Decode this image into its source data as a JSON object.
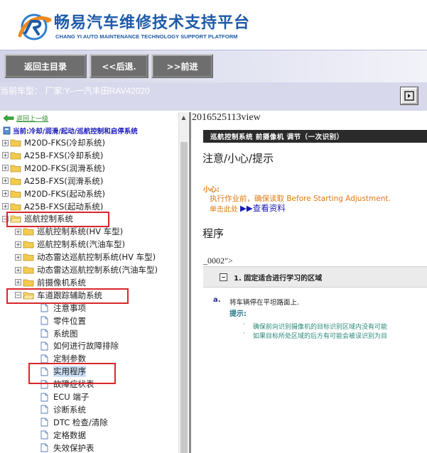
{
  "header": {
    "title_cn": "畅易汽车维修技术支持平台",
    "title_en": "CHANG YI AUTO MAINTENANCE TECHNOLOGY SUPPORT PLATFORM",
    "logo_icon": "auto-repair-logo-icon"
  },
  "toolbar": {
    "main_menu_label": "返回主目录",
    "back_label": "<<后退.",
    "forward_label": ">>前进"
  },
  "model_bar": {
    "current_model": "当前车型： 厂家:Y--一汽丰田RAV42020",
    "collapse_icon": "collapse-panel-icon"
  },
  "nav": {
    "back_link": "返回上一级",
    "breadcrumb": "当前:冷却/润滑/起动/巡航控制和启停系统",
    "tree": [
      {
        "label": "M20D-FKS(冷却系统)",
        "level": 0,
        "expanded": false
      },
      {
        "label": "A25B-FXS(冷却系统)",
        "level": 0,
        "expanded": false
      },
      {
        "label": "M20D-FKS(润滑系统)",
        "level": 0,
        "expanded": false
      },
      {
        "label": "A25B-FXS(润滑系统)",
        "level": 0,
        "expanded": false
      },
      {
        "label": "M20D-FKS(起动系统)",
        "level": 0,
        "expanded": false
      },
      {
        "label": "A25B-FXS(起动系统)",
        "level": 0,
        "expanded": false
      },
      {
        "label": "巡航控制系统",
        "level": 0,
        "expanded": true
      },
      {
        "label": "巡航控制系统(HV 车型)",
        "level": 1,
        "expanded": false
      },
      {
        "label": "巡航控制系统(汽油车型)",
        "level": 1,
        "expanded": false
      },
      {
        "label": "动态雷达巡航控制系统(HV 车型)",
        "level": 1,
        "expanded": false
      },
      {
        "label": "动态雷达巡航控制系统(汽油车型)",
        "level": 1,
        "expanded": false
      },
      {
        "label": "前摄像机系统",
        "level": 1,
        "expanded": false
      },
      {
        "label": "车道跟踪辅助系统",
        "level": 1,
        "expanded": true
      },
      {
        "label": "注意事项",
        "level": 2,
        "type": "doc"
      },
      {
        "label": "零件位置",
        "level": 2,
        "type": "doc"
      },
      {
        "label": "系统图",
        "level": 2,
        "type": "doc"
      },
      {
        "label": "如何进行故障排除",
        "level": 2,
        "type": "doc"
      },
      {
        "label": "定制参数",
        "level": 2,
        "type": "doc"
      },
      {
        "label": "实用程序",
        "level": 2,
        "type": "doc",
        "selected": true
      },
      {
        "label": "故障症状表",
        "level": 2,
        "type": "doc"
      },
      {
        "label": "ECU 端子",
        "level": 2,
        "type": "doc"
      },
      {
        "label": "诊断系统",
        "level": 2,
        "type": "doc"
      },
      {
        "label": "DTC 检查/清除",
        "level": 2,
        "type": "doc"
      },
      {
        "label": "定格数据",
        "level": 2,
        "type": "doc"
      },
      {
        "label": "失效保护表",
        "level": 2,
        "type": "doc"
      }
    ]
  },
  "content": {
    "view_title": "2016525113view",
    "doc_path": "巡航控制系统 前摄像机 调节（一次识别）",
    "notice_heading": "注意/小心/提示",
    "caution_label": "小心:",
    "caution_text": "执行作业前，确保读取 Before Starting Adjustment.",
    "see_prefix": "单击此处",
    "see_link": "▶▶查看资料",
    "procedure_heading": "程序",
    "stray_text": "_0002\">",
    "section_title": "1. 固定适合进行学习的区域",
    "step_marker": "a.",
    "step_text": "将车辆停在平坦路面上.",
    "hint_label": "提示:",
    "hints": [
      "确保前向识别摄像机的目标识别区域内没有可能",
      "如果目标所处区域的后方有可能会被误识别为目"
    ]
  },
  "colors": {
    "brand_blue": "#1e5aa8",
    "highlight_red": "#d9262c",
    "caution_orange": "#e07a10",
    "link_blue": "#1a1ab8"
  }
}
